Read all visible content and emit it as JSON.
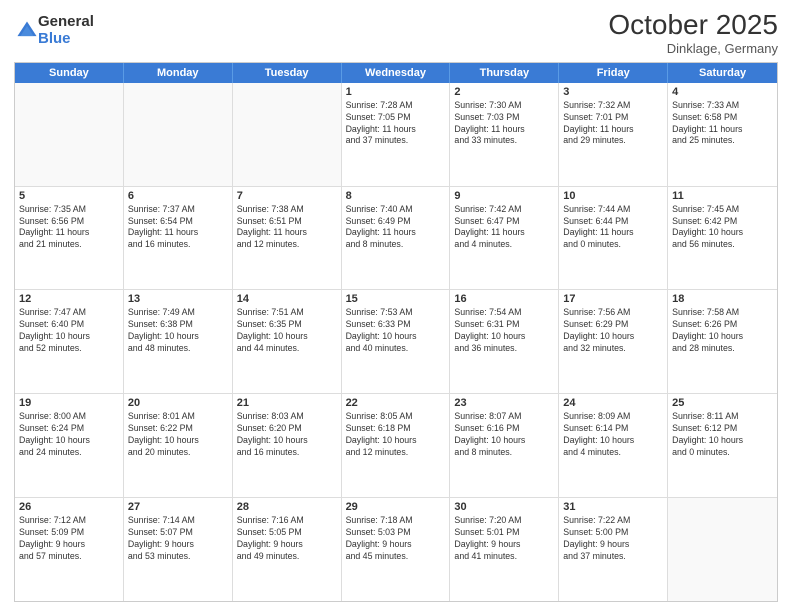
{
  "logo": {
    "general": "General",
    "blue": "Blue"
  },
  "header": {
    "month": "October 2025",
    "location": "Dinklage, Germany"
  },
  "weekdays": [
    "Sunday",
    "Monday",
    "Tuesday",
    "Wednesday",
    "Thursday",
    "Friday",
    "Saturday"
  ],
  "rows": [
    [
      {
        "day": "",
        "info": ""
      },
      {
        "day": "",
        "info": ""
      },
      {
        "day": "",
        "info": ""
      },
      {
        "day": "1",
        "info": "Sunrise: 7:28 AM\nSunset: 7:05 PM\nDaylight: 11 hours\nand 37 minutes."
      },
      {
        "day": "2",
        "info": "Sunrise: 7:30 AM\nSunset: 7:03 PM\nDaylight: 11 hours\nand 33 minutes."
      },
      {
        "day": "3",
        "info": "Sunrise: 7:32 AM\nSunset: 7:01 PM\nDaylight: 11 hours\nand 29 minutes."
      },
      {
        "day": "4",
        "info": "Sunrise: 7:33 AM\nSunset: 6:58 PM\nDaylight: 11 hours\nand 25 minutes."
      }
    ],
    [
      {
        "day": "5",
        "info": "Sunrise: 7:35 AM\nSunset: 6:56 PM\nDaylight: 11 hours\nand 21 minutes."
      },
      {
        "day": "6",
        "info": "Sunrise: 7:37 AM\nSunset: 6:54 PM\nDaylight: 11 hours\nand 16 minutes."
      },
      {
        "day": "7",
        "info": "Sunrise: 7:38 AM\nSunset: 6:51 PM\nDaylight: 11 hours\nand 12 minutes."
      },
      {
        "day": "8",
        "info": "Sunrise: 7:40 AM\nSunset: 6:49 PM\nDaylight: 11 hours\nand 8 minutes."
      },
      {
        "day": "9",
        "info": "Sunrise: 7:42 AM\nSunset: 6:47 PM\nDaylight: 11 hours\nand 4 minutes."
      },
      {
        "day": "10",
        "info": "Sunrise: 7:44 AM\nSunset: 6:44 PM\nDaylight: 11 hours\nand 0 minutes."
      },
      {
        "day": "11",
        "info": "Sunrise: 7:45 AM\nSunset: 6:42 PM\nDaylight: 10 hours\nand 56 minutes."
      }
    ],
    [
      {
        "day": "12",
        "info": "Sunrise: 7:47 AM\nSunset: 6:40 PM\nDaylight: 10 hours\nand 52 minutes."
      },
      {
        "day": "13",
        "info": "Sunrise: 7:49 AM\nSunset: 6:38 PM\nDaylight: 10 hours\nand 48 minutes."
      },
      {
        "day": "14",
        "info": "Sunrise: 7:51 AM\nSunset: 6:35 PM\nDaylight: 10 hours\nand 44 minutes."
      },
      {
        "day": "15",
        "info": "Sunrise: 7:53 AM\nSunset: 6:33 PM\nDaylight: 10 hours\nand 40 minutes."
      },
      {
        "day": "16",
        "info": "Sunrise: 7:54 AM\nSunset: 6:31 PM\nDaylight: 10 hours\nand 36 minutes."
      },
      {
        "day": "17",
        "info": "Sunrise: 7:56 AM\nSunset: 6:29 PM\nDaylight: 10 hours\nand 32 minutes."
      },
      {
        "day": "18",
        "info": "Sunrise: 7:58 AM\nSunset: 6:26 PM\nDaylight: 10 hours\nand 28 minutes."
      }
    ],
    [
      {
        "day": "19",
        "info": "Sunrise: 8:00 AM\nSunset: 6:24 PM\nDaylight: 10 hours\nand 24 minutes."
      },
      {
        "day": "20",
        "info": "Sunrise: 8:01 AM\nSunset: 6:22 PM\nDaylight: 10 hours\nand 20 minutes."
      },
      {
        "day": "21",
        "info": "Sunrise: 8:03 AM\nSunset: 6:20 PM\nDaylight: 10 hours\nand 16 minutes."
      },
      {
        "day": "22",
        "info": "Sunrise: 8:05 AM\nSunset: 6:18 PM\nDaylight: 10 hours\nand 12 minutes."
      },
      {
        "day": "23",
        "info": "Sunrise: 8:07 AM\nSunset: 6:16 PM\nDaylight: 10 hours\nand 8 minutes."
      },
      {
        "day": "24",
        "info": "Sunrise: 8:09 AM\nSunset: 6:14 PM\nDaylight: 10 hours\nand 4 minutes."
      },
      {
        "day": "25",
        "info": "Sunrise: 8:11 AM\nSunset: 6:12 PM\nDaylight: 10 hours\nand 0 minutes."
      }
    ],
    [
      {
        "day": "26",
        "info": "Sunrise: 7:12 AM\nSunset: 5:09 PM\nDaylight: 9 hours\nand 57 minutes."
      },
      {
        "day": "27",
        "info": "Sunrise: 7:14 AM\nSunset: 5:07 PM\nDaylight: 9 hours\nand 53 minutes."
      },
      {
        "day": "28",
        "info": "Sunrise: 7:16 AM\nSunset: 5:05 PM\nDaylight: 9 hours\nand 49 minutes."
      },
      {
        "day": "29",
        "info": "Sunrise: 7:18 AM\nSunset: 5:03 PM\nDaylight: 9 hours\nand 45 minutes."
      },
      {
        "day": "30",
        "info": "Sunrise: 7:20 AM\nSunset: 5:01 PM\nDaylight: 9 hours\nand 41 minutes."
      },
      {
        "day": "31",
        "info": "Sunrise: 7:22 AM\nSunset: 5:00 PM\nDaylight: 9 hours\nand 37 minutes."
      },
      {
        "day": "",
        "info": ""
      }
    ]
  ]
}
